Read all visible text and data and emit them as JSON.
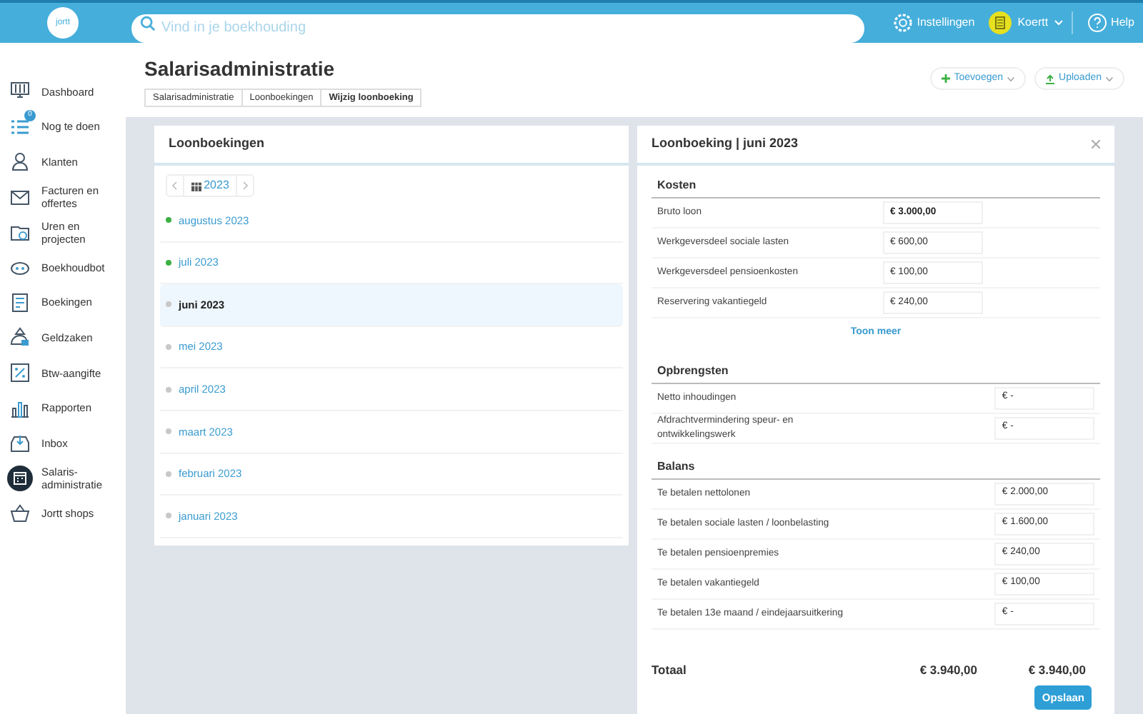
{
  "logo": "jortt",
  "search": {
    "placeholder": "Vind in je boekhouding"
  },
  "topbar": {
    "settings": "Instellingen",
    "account": "Koertt",
    "help": "Help"
  },
  "sidebar": {
    "items": [
      {
        "label": "Dashboard",
        "selected": false
      },
      {
        "label": "Nog te doen",
        "selected": false,
        "badge": "0"
      },
      {
        "label": "Klanten",
        "selected": false
      },
      {
        "label": "Facturen en offertes",
        "selected": false
      },
      {
        "label": "Uren en projecten",
        "selected": false
      },
      {
        "label": "Boekhoudbot",
        "selected": false
      },
      {
        "label": "Boekingen",
        "selected": false
      },
      {
        "label": "Geldzaken",
        "selected": false
      },
      {
        "label": "Btw-aangifte",
        "selected": false
      },
      {
        "label": "Rapporten",
        "selected": false
      },
      {
        "label": "Inbox",
        "selected": false
      },
      {
        "label": "Salaris-administratie",
        "selected": true
      },
      {
        "label": "Jortt shops",
        "selected": false
      }
    ]
  },
  "page": {
    "title": "Salarisadministratie",
    "breadcrumbs": [
      "Salarisadministratie",
      "Loonboekingen",
      "Wijzig loonboeking"
    ],
    "actions": [
      "Toevoegen",
      "Uploaden"
    ]
  },
  "list_panel": {
    "title": "Loonboekingen",
    "year": "2023",
    "months": [
      {
        "label": "augustus 2023",
        "color": "#3cb043",
        "selected": false
      },
      {
        "label": "juli 2023",
        "color": "#3cb043",
        "selected": false
      },
      {
        "label": "juni 2023",
        "color": "#c8c8c8",
        "selected": true
      },
      {
        "label": "mei 2023",
        "color": "#c8c8c8",
        "selected": false
      },
      {
        "label": "april 2023",
        "color": "#c8c8c8",
        "selected": false
      },
      {
        "label": "maart 2023",
        "color": "#c8c8c8",
        "selected": false
      },
      {
        "label": "februari 2023",
        "color": "#c8c8c8",
        "selected": false
      },
      {
        "label": "januari 2023",
        "color": "#c8c8c8",
        "selected": false
      }
    ]
  },
  "detail_panel": {
    "title": "Loonboeking | juni 2023",
    "sections": [
      {
        "title": "Kosten",
        "rows": [
          {
            "label": "Bruto loon",
            "value": "€ 3.000,00",
            "kind": "debit",
            "bold": true
          },
          {
            "label": "Werkgeversdeel sociale lasten",
            "value": "€ 600,00",
            "kind": "debit",
            "bold": false
          },
          {
            "label": "Werkgeversdeel pensioenkosten",
            "value": "€ 100,00",
            "kind": "debit",
            "bold": false
          },
          {
            "label": "Reservering vakantiegeld",
            "value": "€ 240,00",
            "kind": "debit",
            "bold": false
          }
        ],
        "more": "Toon meer"
      },
      {
        "title": "Opbrengsten",
        "rows": [
          {
            "label": "Netto inhoudingen",
            "value": "€ -",
            "kind": "credit",
            "bold": false
          },
          {
            "label": "Afdrachtvermindering speur- en ontwikkelingswerk",
            "value": "€ -",
            "kind": "credit",
            "bold": false
          }
        ]
      },
      {
        "title": "Balans",
        "rows": [
          {
            "label": "Te betalen nettolonen",
            "value": "€ 2.000,00",
            "kind": "credit",
            "bold": false
          },
          {
            "label": "Te betalen sociale lasten / loonbelasting",
            "value": "€ 1.600,00",
            "kind": "credit",
            "bold": false
          },
          {
            "label": "Te betalen pensioenpremies",
            "value": "€ 240,00",
            "kind": "credit",
            "bold": false
          },
          {
            "label": "Te betalen vakantiegeld",
            "value": "€ 100,00",
            "kind": "credit",
            "bold": false
          },
          {
            "label": "Te betalen 13e maand / eindejaarsuitkering",
            "value": "€ -",
            "kind": "credit",
            "bold": false
          }
        ]
      }
    ],
    "total": {
      "label": "Totaal",
      "debit": "€ 3.940,00",
      "credit": "€ 3.940,00"
    },
    "save": "Opslaan"
  }
}
